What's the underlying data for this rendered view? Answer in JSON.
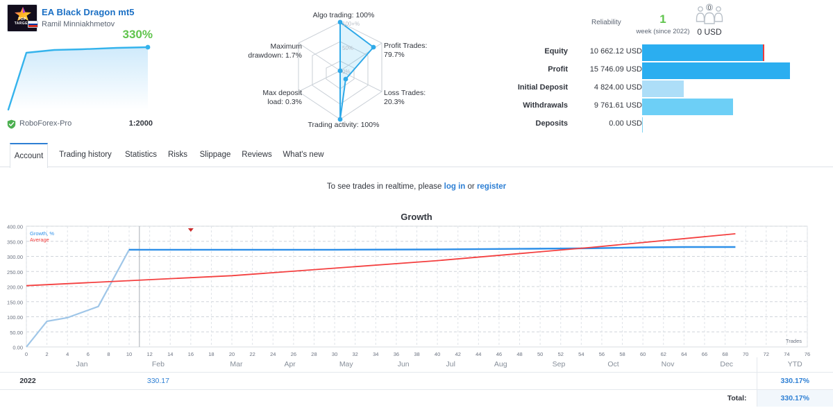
{
  "header": {
    "title": "EA Black Dragon mt5",
    "author": "Ramil Minniakhmetov",
    "logo_text_1": "TOP",
    "logo_text_2": "TARGET",
    "growth_percent": "330%",
    "broker": "RoboForex-Pro",
    "leverage": "1:2000"
  },
  "radar": {
    "scale_outer": "100+%",
    "scale_mid": "50%",
    "scale_inner": "0%",
    "axes": [
      {
        "key": "algo_trading",
        "label": "Algo trading: 100%",
        "value": 100
      },
      {
        "key": "profit_trades",
        "label": "Profit Trades:\n79.7%",
        "value": 79.7
      },
      {
        "key": "loss_trades",
        "label": "Loss Trades:\n20.3%",
        "value": 20.3
      },
      {
        "key": "trading_activity",
        "label": "Trading activity: 100%",
        "value": 100
      },
      {
        "key": "max_deposit_load",
        "label": "Max deposit\nload: 0.3%",
        "value": 0.3
      },
      {
        "key": "max_drawdown",
        "label": "Maximum\ndrawdown: 1.7%",
        "value": 1.7
      }
    ]
  },
  "reliability": {
    "label": "Reliability",
    "value": "1",
    "sub": "week (since 2022)",
    "subscribers_count": "0",
    "subscribers_amount": "0 USD"
  },
  "stats": {
    "rows": [
      {
        "name": "Equity",
        "value": "10 662.12 USD",
        "pct": 81,
        "color": "#2BAEF0",
        "cap": true
      },
      {
        "name": "Profit",
        "value": "15 746.09 USD",
        "pct": 99,
        "color": "#2BAEF0",
        "cap": false
      },
      {
        "name": "Initial Deposit",
        "value": "4 824.00 USD",
        "pct": 28,
        "color": "#ADDEF8",
        "cap": false
      },
      {
        "name": "Withdrawals",
        "value": "9 761.61 USD",
        "pct": 61,
        "color": "#6DCFF6",
        "cap": false
      },
      {
        "name": "Deposits",
        "value": "0.00 USD",
        "pct": 0,
        "color": "#7FD3F2",
        "cap": false
      }
    ]
  },
  "tabs": {
    "items": [
      {
        "label": "Account",
        "active": true
      },
      {
        "label": "Trading history",
        "active": false
      },
      {
        "label": "Statistics",
        "active": false
      },
      {
        "label": "Risks",
        "active": false
      },
      {
        "label": "Slippage",
        "active": false
      },
      {
        "label": "Reviews",
        "active": false
      },
      {
        "label": "What's new",
        "active": false
      }
    ]
  },
  "notice": {
    "prefix": "To see trades in realtime, please ",
    "login": "log in",
    "middle": " or ",
    "register": "register"
  },
  "chart_data": {
    "type": "line",
    "title": "Growth",
    "xlabel": "Trades",
    "ylabel": "",
    "xlim": [
      0,
      76
    ],
    "ylim": [
      0,
      400
    ],
    "xticks": [
      0,
      2,
      4,
      6,
      8,
      10,
      12,
      14,
      16,
      18,
      20,
      22,
      24,
      26,
      28,
      30,
      32,
      34,
      36,
      38,
      40,
      42,
      44,
      46,
      48,
      50,
      52,
      54,
      56,
      58,
      60,
      62,
      64,
      66,
      68,
      70,
      72,
      74,
      76
    ],
    "yticks": [
      "0.00",
      "50.00",
      "100.00",
      "150.00",
      "200.00",
      "250.00",
      "300.00",
      "350.00",
      "400.00"
    ],
    "grid": true,
    "legend_position": "top-left",
    "marker": {
      "x": 16,
      "y": 400,
      "color": "#cc2b2b",
      "shape": "triangle-down"
    },
    "vertical_divider_x": 11,
    "series": [
      {
        "name": "Growth, %",
        "color": "#2d8fe8",
        "early_color": "#9fc6e8",
        "points": [
          {
            "x": 0,
            "y": 0
          },
          {
            "x": 2,
            "y": 85
          },
          {
            "x": 4,
            "y": 97
          },
          {
            "x": 7,
            "y": 134
          },
          {
            "x": 10,
            "y": 322
          },
          {
            "x": 11,
            "y": 322
          },
          {
            "x": 20,
            "y": 322
          },
          {
            "x": 30,
            "y": 322
          },
          {
            "x": 40,
            "y": 323
          },
          {
            "x": 48,
            "y": 325
          },
          {
            "x": 55,
            "y": 327
          },
          {
            "x": 60,
            "y": 330
          },
          {
            "x": 64,
            "y": 331
          },
          {
            "x": 69,
            "y": 331
          }
        ]
      },
      {
        "name": "Average",
        "color": "#f43f3f",
        "points": [
          {
            "x": 0,
            "y": 203
          },
          {
            "x": 20,
            "y": 236
          },
          {
            "x": 40,
            "y": 286
          },
          {
            "x": 55,
            "y": 330
          },
          {
            "x": 69,
            "y": 375
          }
        ]
      }
    ]
  },
  "month_table": {
    "headers": [
      "",
      "Jan",
      "Feb",
      "Mar",
      "Apr",
      "May",
      "Jun",
      "Jul",
      "Aug",
      "Sep",
      "Oct",
      "Nov",
      "Dec",
      "YTD"
    ],
    "rows": [
      {
        "year": "2022",
        "values": [
          "",
          "330.17",
          "",
          "",
          "",
          "",
          "",
          "",
          "",
          "",
          "",
          ""
        ],
        "ytd": "330.17%"
      }
    ],
    "total_label": "Total:",
    "total_value": "330.17%"
  }
}
